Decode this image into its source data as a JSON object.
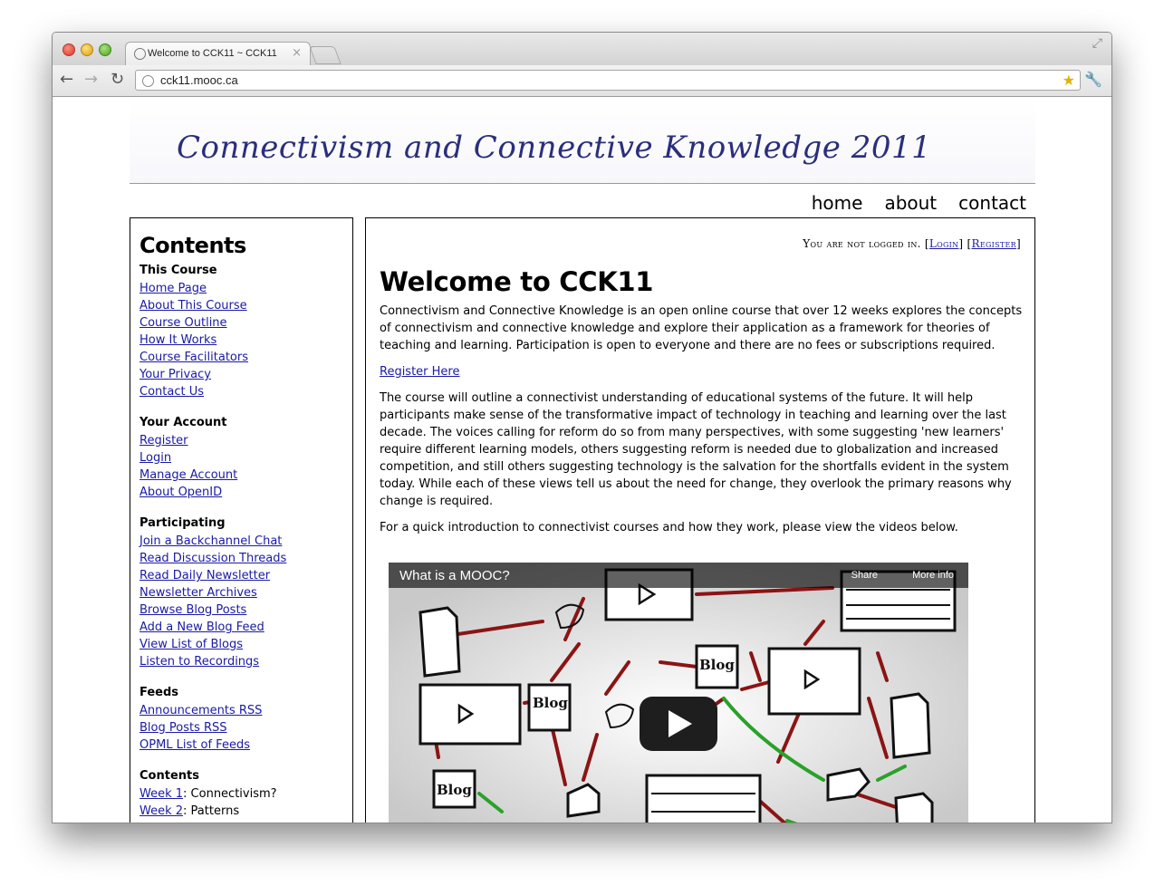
{
  "browser": {
    "tab_title": "Welcome to CCK11 ~ CCK11",
    "tab_close": "×",
    "url": "cck11.mooc.ca"
  },
  "banner": {
    "title": "Connectivism and Connective Knowledge 2011"
  },
  "topnav": [
    "home",
    "about",
    "contact"
  ],
  "sidebar": {
    "heading": "Contents",
    "sections": [
      {
        "title": "This Course",
        "links": [
          "Home Page",
          "About This Course",
          "Course Outline",
          "How It Works",
          "Course Facilitators",
          "Your Privacy",
          "Contact Us"
        ]
      },
      {
        "title": "Your Account",
        "links": [
          "Register",
          "Login",
          "Manage Account",
          "About OpenID"
        ]
      },
      {
        "title": "Participating",
        "links": [
          "Join a Backchannel Chat",
          "Read Discussion Threads",
          "Read Daily Newsletter",
          "Newsletter Archives",
          "Browse Blog Posts",
          "Add a New Blog Feed",
          "View List of Blogs",
          "Listen to Recordings"
        ]
      },
      {
        "title": "Feeds",
        "links": [
          "Announcements RSS",
          "Blog Posts RSS",
          "OPML List of Feeds"
        ]
      }
    ],
    "contents_title": "Contents",
    "weeks": [
      {
        "link": "Week 1",
        "rest": ": Connectivism?"
      },
      {
        "link": "Week 2",
        "rest": ": Patterns"
      }
    ]
  },
  "main": {
    "login_prefix": "You are not logged in. [",
    "login_link": "Login",
    "login_mid": "] [",
    "register_link": "Register",
    "login_suffix": "]",
    "title": "Welcome to CCK11",
    "intro": "Connectivism and Connective Knowledge is an open online course that over 12 weeks explores the concepts of connectivism and connective knowledge and explore their application as a framework for theories of teaching and learning. Participation is open to everyone and there are no fees or subscriptions required.",
    "register_here": "Register Here",
    "para2": "The course will outline a connectivist understanding of educational systems of the future. It will help participants make sense of the transformative impact of technology in teaching and learning over the last decade. The voices calling for reform do so from many perspectives, with some suggesting 'new learners' require different learning models, others suggesting reform is needed due to globalization and increased competition, and still others suggesting technology is the salvation for the shortfalls evident in the system today. While each of these views tell us about the need for change, they overlook the primary reasons why change is required.",
    "para3": "For a quick introduction to connectivist courses and how they work, please view the videos below.",
    "video": {
      "title": "What is a MOOC?",
      "share": "Share",
      "more_info": "More info",
      "art_labels": [
        "Blog",
        "Blog",
        "Blog"
      ]
    }
  }
}
